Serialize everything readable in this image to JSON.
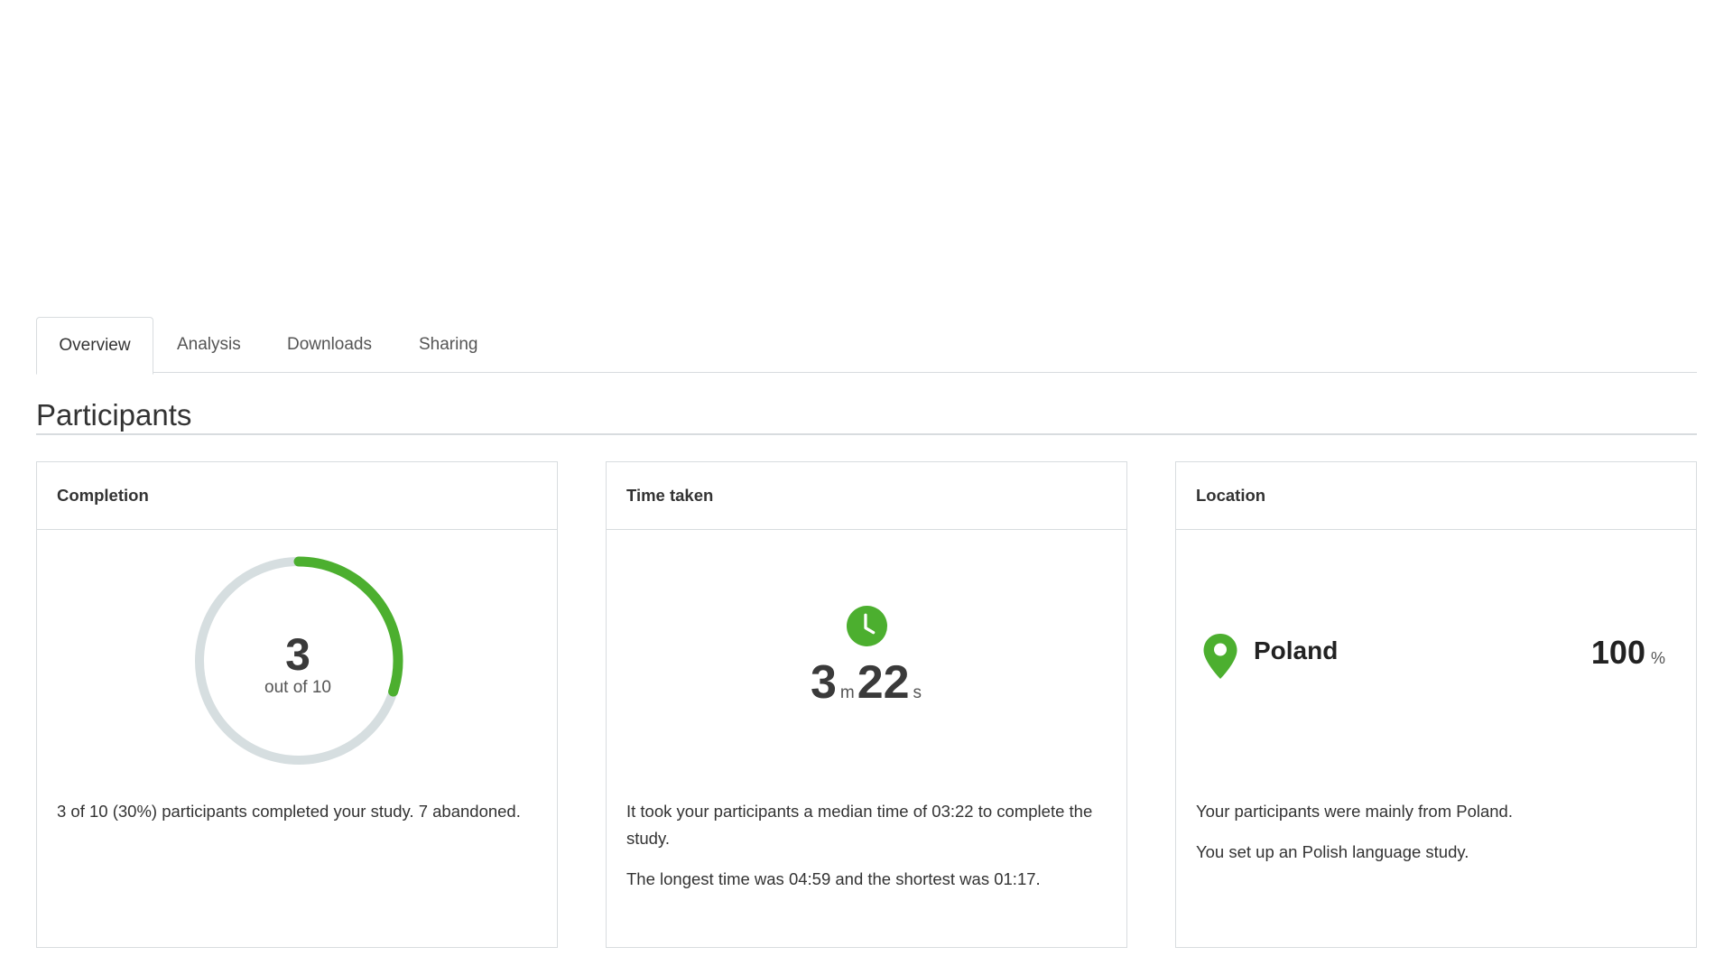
{
  "tabs": [
    {
      "label": "Overview",
      "active": true
    },
    {
      "label": "Analysis",
      "active": false
    },
    {
      "label": "Downloads",
      "active": false
    },
    {
      "label": "Sharing",
      "active": false
    }
  ],
  "section": {
    "title": "Participants"
  },
  "colors": {
    "accent": "#4caf2f",
    "track": "#d6dee0",
    "border": "#d8dcdf"
  },
  "completion": {
    "header": "Completion",
    "completed": "3",
    "out_of_label": "out of 10",
    "fraction": 0.3,
    "text": "3 of 10 (30%) participants completed your study. 7 abandoned."
  },
  "time_taken": {
    "header": "Time taken",
    "icon": "clock-icon",
    "minutes": "3",
    "minutes_unit": "m",
    "seconds": "22",
    "seconds_unit": "s",
    "text_1": "It took your participants a median time of 03:22 to complete the study.",
    "text_2": "The longest time was 04:59 and the shortest was 01:17."
  },
  "location": {
    "header": "Location",
    "icon": "map-pin-icon",
    "country": "Poland",
    "percent": "100",
    "percent_sign": "%",
    "text_1": "Your participants were mainly from Poland.",
    "text_2": "You set up an Polish language study."
  }
}
